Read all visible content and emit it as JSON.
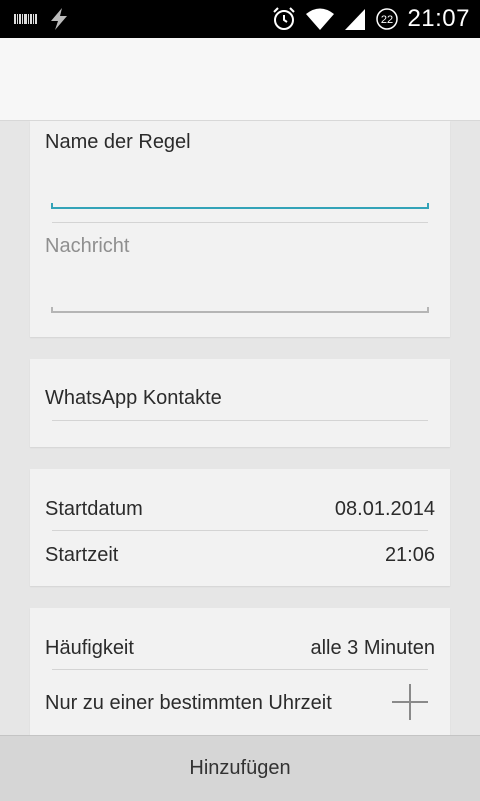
{
  "status_bar": {
    "time": "21:07",
    "notification_badge": "22",
    "icons": [
      "barcode-icon",
      "lightning-icon",
      "alarm-icon",
      "wifi-icon",
      "signal-icon",
      "notification-count-icon"
    ]
  },
  "form": {
    "rule_name": {
      "label": "Name der Regel",
      "value": ""
    },
    "message": {
      "placeholder": "Nachricht",
      "value": ""
    },
    "contacts": {
      "label": "WhatsApp Kontakte"
    },
    "start_date": {
      "label": "Startdatum",
      "value": "08.01.2014"
    },
    "start_time": {
      "label": "Startzeit",
      "value": "21:06"
    },
    "frequency": {
      "label": "Häufigkeit",
      "value": "alle 3 Minuten"
    },
    "specific_time": {
      "label": "Nur zu einer bestimmten Uhrzeit"
    }
  },
  "footer": {
    "add_button_label": "Hinzufügen"
  },
  "colors": {
    "accent": "#33a3b8",
    "background": "#e6e6e6",
    "card": "#f2f2f2",
    "status_bar": "#000000"
  }
}
